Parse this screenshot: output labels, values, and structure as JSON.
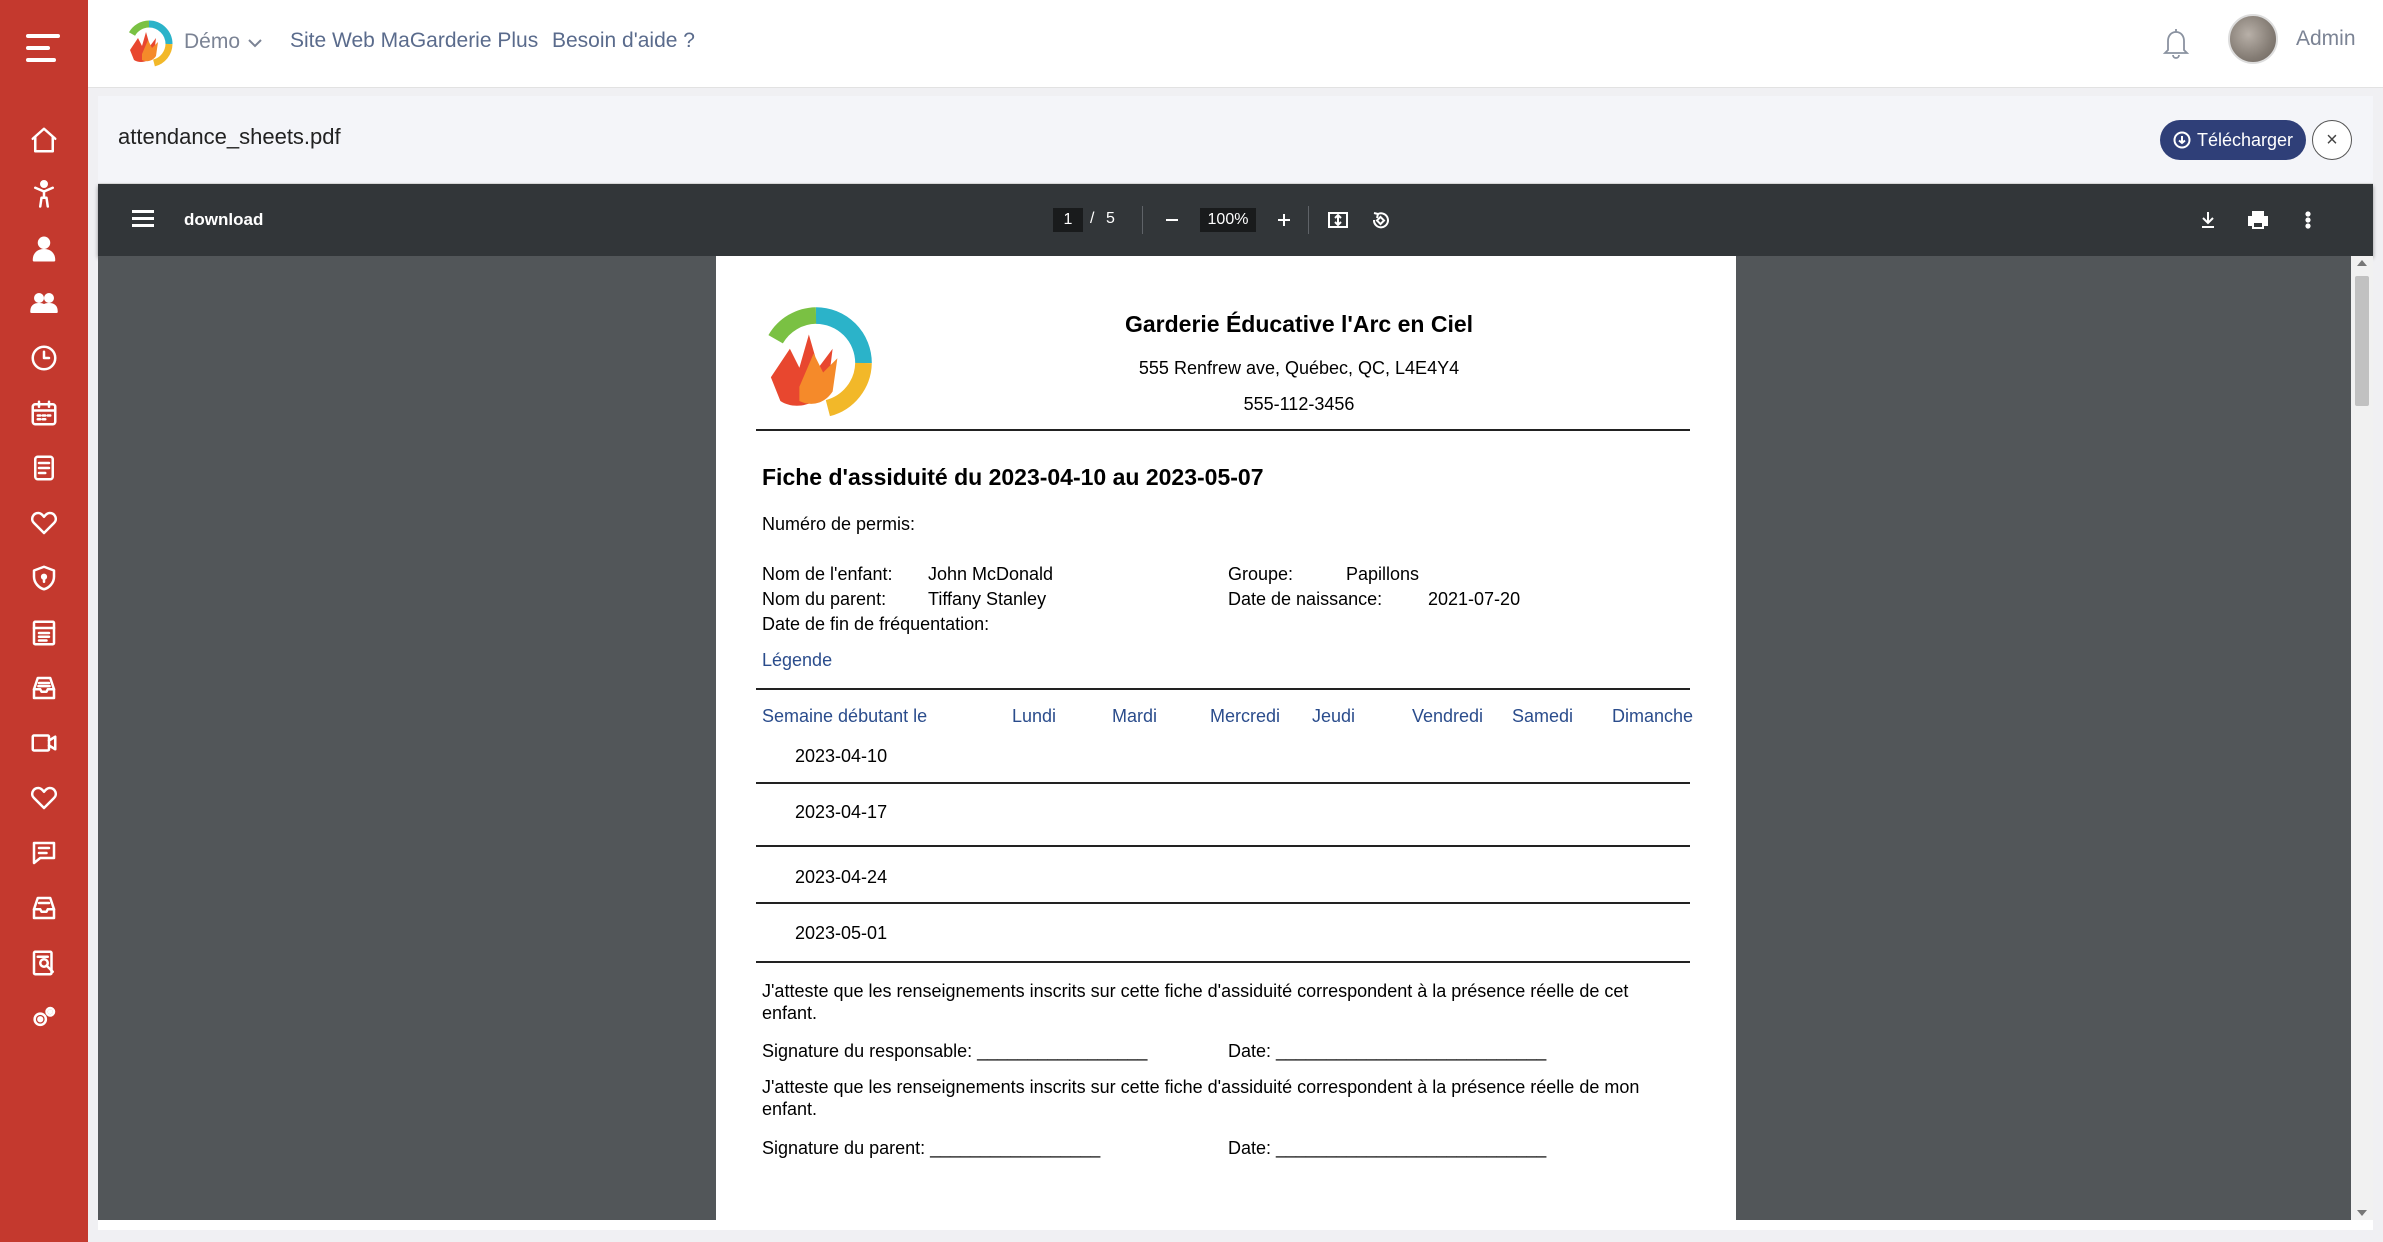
{
  "topbar": {
    "demo_label": "Démo",
    "site_link": "Site Web MaGarderie Plus",
    "help_link": "Besoin d'aide ?",
    "user_name": "Admin"
  },
  "sidebar": {
    "items": [
      {
        "icon": "home-icon"
      },
      {
        "icon": "child-icon"
      },
      {
        "icon": "staff-icon"
      },
      {
        "icon": "group-icon"
      },
      {
        "icon": "clock-icon"
      },
      {
        "icon": "calendar-icon"
      },
      {
        "icon": "report-icon"
      },
      {
        "icon": "heart-icon"
      },
      {
        "icon": "shield-icon"
      },
      {
        "icon": "menu-board-icon"
      },
      {
        "icon": "inbox-icon"
      },
      {
        "icon": "video-icon"
      },
      {
        "icon": "heart-outline-icon"
      },
      {
        "icon": "message-icon"
      },
      {
        "icon": "tray-icon"
      },
      {
        "icon": "search-report-icon"
      },
      {
        "icon": "settings-icon"
      }
    ],
    "color": "#c4392e"
  },
  "viewer": {
    "filename": "attendance_sheets.pdf",
    "download_button": "Télécharger",
    "close_symbol": "×"
  },
  "pdf_toolbar": {
    "title": "download",
    "current_page": "1",
    "page_separator": "/",
    "total_pages": "5",
    "zoom": "100%"
  },
  "document": {
    "org_name": "Garderie Éducative l'Arc en Ciel",
    "address": "555 Renfrew ave, Québec, QC, L4E4Y4",
    "phone": "555-112-3456",
    "sheet_title": "Fiche d'assiduité du 2023-04-10 au 2023-05-07",
    "permit_label": "Numéro de permis:",
    "child_label": "Nom de l'enfant:",
    "child_value": "John McDonald",
    "group_label": "Groupe:",
    "group_value": "Papillons",
    "parent_label": "Nom du parent:",
    "parent_value": "Tiffany Stanley",
    "birth_label": "Date de naissance:",
    "birth_value": "2021-07-20",
    "end_label": "Date de fin de fréquentation:",
    "legend_label": "Légende",
    "table_headers": [
      "Semaine débutant le",
      "Lundi",
      "Mardi",
      "Mercredi",
      "Jeudi",
      "Vendredi",
      "Samedi",
      "Dimanche"
    ],
    "weeks": [
      "2023-04-10",
      "2023-04-17",
      "2023-04-24",
      "2023-05-01"
    ],
    "attest_responsible": "J'atteste que les renseignements inscrits sur cette fiche d'assiduité correspondent à la présence réelle de cet enfant.",
    "sign_responsible": "Signature du responsable: _________________",
    "date_1": "Date: ___________________________",
    "attest_parent": "J'atteste que les renseignements inscrits sur cette fiche d'assiduité correspondent à la présence réelle de mon enfant.",
    "sign_parent": "Signature du parent: _________________",
    "date_2": "Date: ___________________________"
  }
}
